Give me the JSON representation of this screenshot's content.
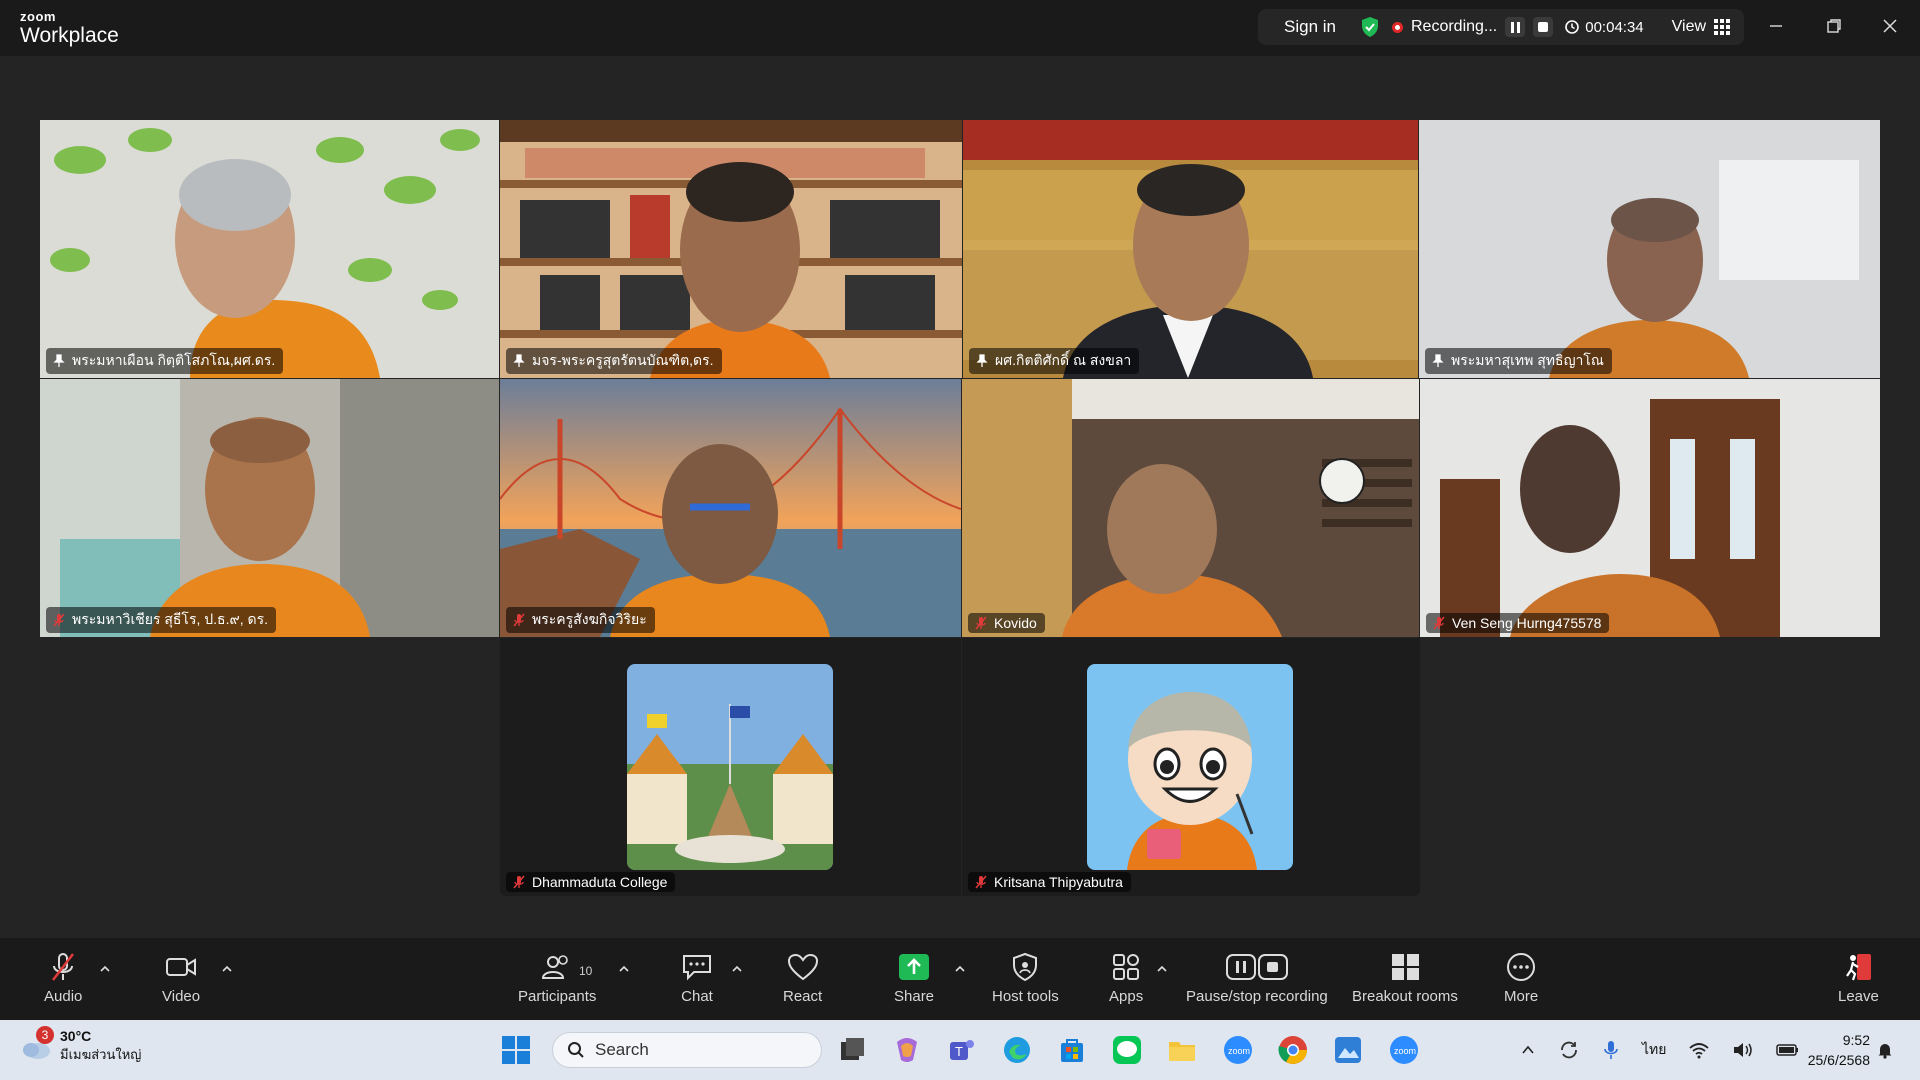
{
  "app": {
    "brand_small": "zoom",
    "brand_big": "Workplace"
  },
  "titlebar": {
    "signin_label": "Sign in",
    "recording_label": "Recording...",
    "timer": "00:04:34",
    "view_label": "View"
  },
  "participants": [
    {
      "name": "พระมหาเผือน กิตฺติโสภโณ,ผศ.ดร.",
      "status": "pinned"
    },
    {
      "name": "มจร-พระครูสุตรัตนบัณฑิต,ดร.",
      "status": "pinned",
      "active_speaker": true
    },
    {
      "name": "ผศ.กิตติศักดิ์ ณ สงขลา",
      "status": "pinned"
    },
    {
      "name": "พระมหาสุเทพ สุทธิญาโณ",
      "status": "pinned"
    },
    {
      "name": "พระมหาวิเชียร สุธีโร, ป.ธ.๙, ดร.",
      "status": "muted"
    },
    {
      "name": "พระครูสังฆกิจวิริยะ",
      "status": "muted"
    },
    {
      "name": "Kovido",
      "status": "muted"
    },
    {
      "name": "Ven Seng Hurng475578",
      "status": "muted"
    },
    {
      "name": "Dhammaduta College",
      "status": "muted"
    },
    {
      "name": "Kritsana Thipyabutra",
      "status": "muted"
    }
  ],
  "toolbar": {
    "audio": "Audio",
    "video": "Video",
    "participants": "Participants",
    "participants_count": "10",
    "chat": "Chat",
    "react": "React",
    "share": "Share",
    "host_tools": "Host tools",
    "apps": "Apps",
    "pause_stop": "Pause/stop recording",
    "breakout": "Breakout rooms",
    "more": "More",
    "leave": "Leave"
  },
  "taskbar": {
    "weather_temp": "30°C",
    "weather_desc": "มีเมฆส่วนใหญ่",
    "weather_badge": "3",
    "search_placeholder": "Search",
    "language": "ไทย",
    "time": "9:52",
    "date": "25/6/2568"
  },
  "colors": {
    "active_speaker": "#23d959",
    "share_green": "#1fb955",
    "recording_red": "#e02828",
    "leave_red": "#e03a3a"
  }
}
